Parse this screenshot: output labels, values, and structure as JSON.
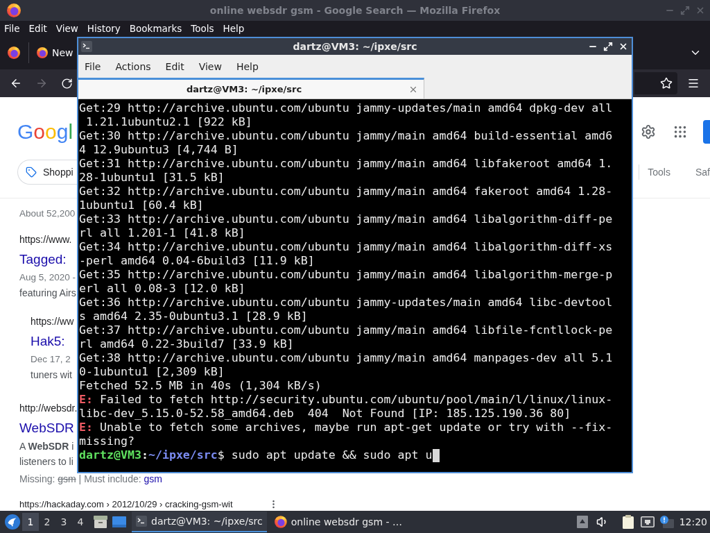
{
  "firefox": {
    "title": "online websdr gsm - Google Search — Mozilla Firefox",
    "active": false,
    "menu": [
      "File",
      "Edit",
      "View",
      "History",
      "Bookmarks",
      "Tools",
      "Help"
    ],
    "tabs": [
      {
        "label": "New",
        "selected": false
      }
    ],
    "nav": {
      "back_enabled": true,
      "forward_enabled": false
    }
  },
  "google": {
    "logo": [
      {
        "char": "G",
        "color": "#4285f4"
      },
      {
        "char": "o",
        "color": "#ea4335"
      },
      {
        "char": "o",
        "color": "#fbbc05"
      },
      {
        "char": "g",
        "color": "#4285f4"
      },
      {
        "char": "l",
        "color": "#34a853"
      }
    ],
    "filter_chip": "Shoppi",
    "right_controls": [
      "Tools",
      "Saf"
    ],
    "result_stats": "About 52,200",
    "results": [
      {
        "url": "https://www.",
        "title": "Tagged:",
        "date": "Aug 5, 2020 -",
        "snippet_lines": [
          "featuring Airs"
        ],
        "children": [
          {
            "url": "https://ww",
            "title": "Hak5:",
            "date": "Dec 17, 2",
            "snippet_lines": [
              "tuners wit"
            ]
          }
        ]
      },
      {
        "url": "http://websdr.",
        "title": "WebSDR",
        "snippet_lines": [
          "A **WebSDR** i",
          "listeners to li"
        ],
        "missing": {
          "label": "Missing:",
          "struck": [
            "gsm"
          ],
          "separator": "|",
          "include_label": "Must include:",
          "include_links": [
            "gsm"
          ]
        }
      }
    ],
    "next_result_url": "https://hackaday.com › 2012/10/29 › cracking-gsm-wit"
  },
  "terminal": {
    "title": "dartz@VM3: ~/ipxe/src",
    "active": true,
    "menu": [
      "File",
      "Actions",
      "Edit",
      "View",
      "Help"
    ],
    "tabs": [
      {
        "label": "dartz@VM3: ~/ipxe/src",
        "selected": true
      }
    ],
    "lines": [
      {
        "kind": "output",
        "text": "Get:29 http://archive.ubuntu.com/ubuntu jammy-updates/main amd64 dpkg-dev all"
      },
      {
        "kind": "output",
        "text": " 1.21.1ubuntu2.1 [922 kB]"
      },
      {
        "kind": "output",
        "text": "Get:30 http://archive.ubuntu.com/ubuntu jammy/main amd64 build-essential amd6"
      },
      {
        "kind": "output",
        "text": "4 12.9ubuntu3 [4,744 B]"
      },
      {
        "kind": "output",
        "text": "Get:31 http://archive.ubuntu.com/ubuntu jammy/main amd64 libfakeroot amd64 1."
      },
      {
        "kind": "output",
        "text": "28-1ubuntu1 [31.5 kB]"
      },
      {
        "kind": "output",
        "text": "Get:32 http://archive.ubuntu.com/ubuntu jammy/main amd64 fakeroot amd64 1.28-"
      },
      {
        "kind": "output",
        "text": "1ubuntu1 [60.4 kB]"
      },
      {
        "kind": "output",
        "text": "Get:33 http://archive.ubuntu.com/ubuntu jammy/main amd64 libalgorithm-diff-pe"
      },
      {
        "kind": "output",
        "text": "rl all 1.201-1 [41.8 kB]"
      },
      {
        "kind": "output",
        "text": "Get:34 http://archive.ubuntu.com/ubuntu jammy/main amd64 libalgorithm-diff-xs"
      },
      {
        "kind": "output",
        "text": "-perl amd64 0.04-6build3 [11.9 kB]"
      },
      {
        "kind": "output",
        "text": "Get:35 http://archive.ubuntu.com/ubuntu jammy/main amd64 libalgorithm-merge-p"
      },
      {
        "kind": "output",
        "text": "erl all 0.08-3 [12.0 kB]"
      },
      {
        "kind": "output",
        "text": "Get:36 http://archive.ubuntu.com/ubuntu jammy-updates/main amd64 libc-devtool"
      },
      {
        "kind": "output",
        "text": "s amd64 2.35-0ubuntu3.1 [28.9 kB]"
      },
      {
        "kind": "output",
        "text": "Get:37 http://archive.ubuntu.com/ubuntu jammy/main amd64 libfile-fcntllock-pe"
      },
      {
        "kind": "output",
        "text": "rl amd64 0.22-3build7 [33.9 kB]"
      },
      {
        "kind": "output",
        "text": "Get:38 http://archive.ubuntu.com/ubuntu jammy/main amd64 manpages-dev all 5.1"
      },
      {
        "kind": "output",
        "text": "0-1ubuntu1 [2,309 kB]"
      },
      {
        "kind": "output",
        "text": "Fetched 52.5 MB in 40s (1,304 kB/s)"
      },
      {
        "kind": "error",
        "tag": "E:",
        "text": " Failed to fetch http://security.ubuntu.com/ubuntu/pool/main/l/linux/linux-"
      },
      {
        "kind": "output",
        "text": "libc-dev_5.15.0-52.58_amd64.deb  404  Not Found [IP: 185.125.190.36 80]"
      },
      {
        "kind": "error",
        "tag": "E:",
        "text": " Unable to fetch some archives, maybe run apt-get update or try with --fix-"
      },
      {
        "kind": "output",
        "text": "missing?"
      },
      {
        "kind": "prompt",
        "user": "dartz@VM3",
        "sep": ":",
        "path": "~/ipxe/src",
        "command": "$ sudo apt update && sudo apt u",
        "cursor": true
      }
    ]
  },
  "taskbar": {
    "desktops": [
      {
        "label": "1",
        "selected": true
      },
      {
        "label": "2",
        "selected": false
      },
      {
        "label": "3",
        "selected": false
      },
      {
        "label": "4",
        "selected": false
      }
    ],
    "tasks": [
      {
        "kind": "terminal",
        "label": "dartz@VM3: ~/ipxe/src",
        "selected": true
      },
      {
        "kind": "browser",
        "label": "online websdr gsm - …",
        "selected": false
      }
    ],
    "clock": "12:20"
  }
}
